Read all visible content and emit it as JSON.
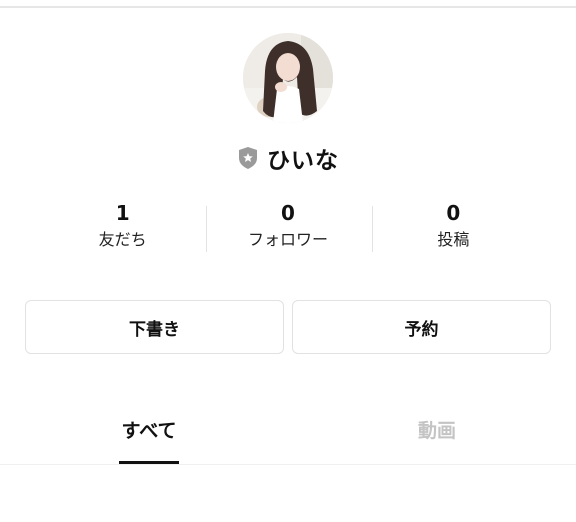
{
  "profile": {
    "name": "ひいな",
    "badge_icon": "shield-star-icon",
    "avatar": "profile-photo"
  },
  "stats": [
    {
      "value": "1",
      "label": "友だち"
    },
    {
      "value": "0",
      "label": "フォロワー"
    },
    {
      "value": "0",
      "label": "投稿"
    }
  ],
  "actions": {
    "drafts_label": "下書き",
    "scheduled_label": "予約"
  },
  "tabs": [
    {
      "label": "すべて",
      "active": true
    },
    {
      "label": "動画",
      "active": false
    }
  ],
  "colors": {
    "active_tab": "#111111",
    "inactive_tab": "#c4c4c4",
    "badge": "#9a9a9a"
  }
}
